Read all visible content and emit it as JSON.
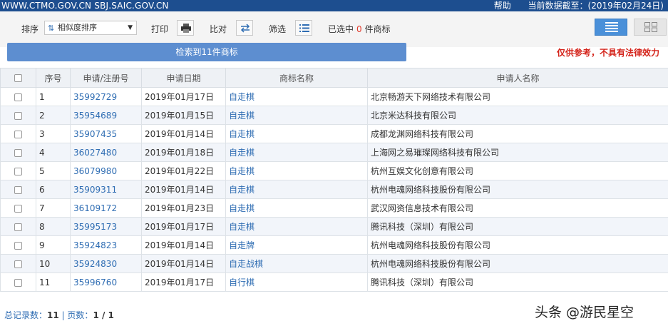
{
  "topbar": {
    "site": "WWW.CTMO.GOV.CN SBJ.SAIC.GOV.CN",
    "help": "帮助",
    "data_date": "当前数据截至：(2019年02月24日)"
  },
  "toolbar": {
    "sort_label": "排序",
    "sort_value": "相似度排序",
    "print_label": "打印",
    "compare_label": "比对",
    "filter_label": "筛选",
    "selected_prefix": "已选中",
    "selected_count": "0",
    "selected_suffix": "件商标"
  },
  "search_result": "检索到11件商标",
  "disclaimer": "仅供参考，不具有法律效力",
  "table": {
    "headers": [
      "序号",
      "申请/注册号",
      "申请日期",
      "商标名称",
      "申请人名称"
    ],
    "rows": [
      {
        "no": "1",
        "reg": "35992729",
        "date": "2019年01月17日",
        "name": "自走棋",
        "applicant": "北京畅游天下网络技术有限公司"
      },
      {
        "no": "2",
        "reg": "35954689",
        "date": "2019年01月15日",
        "name": "自走棋",
        "applicant": "北京米达科技有限公司"
      },
      {
        "no": "3",
        "reg": "35907435",
        "date": "2019年01月14日",
        "name": "自走棋",
        "applicant": "成都龙渊网络科技有限公司"
      },
      {
        "no": "4",
        "reg": "36027480",
        "date": "2019年01月18日",
        "name": "自走棋",
        "applicant": "上海网之易璀璨网络科技有限公司"
      },
      {
        "no": "5",
        "reg": "36079980",
        "date": "2019年01月22日",
        "name": "自走棋",
        "applicant": "杭州互娱文化创意有限公司"
      },
      {
        "no": "6",
        "reg": "35909311",
        "date": "2019年01月14日",
        "name": "自走棋",
        "applicant": "杭州电魂网络科技股份有限公司"
      },
      {
        "no": "7",
        "reg": "36109172",
        "date": "2019年01月23日",
        "name": "自走棋",
        "applicant": "武汉网资信息技术有限公司"
      },
      {
        "no": "8",
        "reg": "35995173",
        "date": "2019年01月17日",
        "name": "自走棋",
        "applicant": "腾讯科技（深圳）有限公司"
      },
      {
        "no": "9",
        "reg": "35924823",
        "date": "2019年01月14日",
        "name": "自走牌",
        "applicant": "杭州电魂网络科技股份有限公司"
      },
      {
        "no": "10",
        "reg": "35924830",
        "date": "2019年01月14日",
        "name": "自走战棋",
        "applicant": "杭州电魂网络科技股份有限公司"
      },
      {
        "no": "11",
        "reg": "35996760",
        "date": "2019年01月17日",
        "name": "自行棋",
        "applicant": "腾讯科技（深圳）有限公司"
      }
    ]
  },
  "footer": {
    "total_label": "总记录数：",
    "total_value": "11",
    "separator": "|",
    "pages_label": "页数：",
    "pages_value": "1 / 1"
  },
  "watermark": "头条 @游民星空"
}
